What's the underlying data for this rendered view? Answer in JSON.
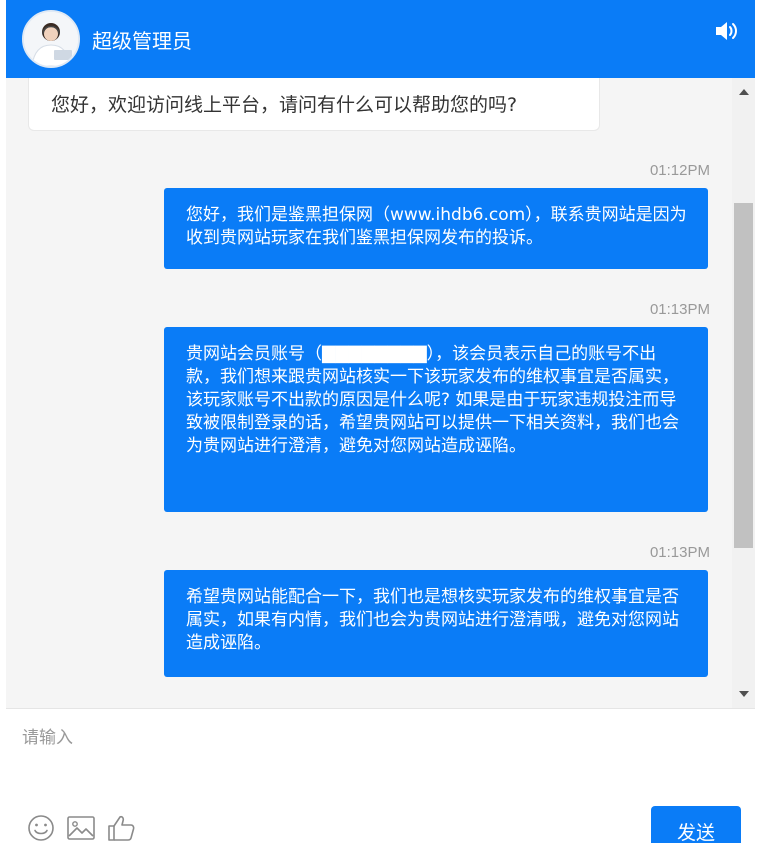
{
  "header": {
    "agent_name": "超级管理员",
    "avatar_icon": "agent-avatar",
    "speaker_icon": "speaker-icon"
  },
  "messages": [
    {
      "sender": "agent",
      "text": "您好，欢迎访问线上平台，请问有什么可以帮助您的吗?"
    },
    {
      "sender": "user",
      "time": "01:12PM",
      "text": "您好，我们是鉴黑担保网（www.ihdb6.com），联系贵网站是因为收到贵网站玩家在我们鉴黑担保网发布的投诉。"
    },
    {
      "sender": "user",
      "time": "01:13PM",
      "text": "贵网站会员账号（▇▇▇▇▇▇▇▇），该会员表示自己的账号不出款，我们想来跟贵网站核实一下该玩家发布的维权事宜是否属实，该玩家账号不出款的原因是什么呢? 如果是由于玩家违规投注而导致被限制登录的话，希望贵网站可以提供一下相关资料，我们也会为贵网站进行澄清，避免对您网站造成诬陷。"
    },
    {
      "sender": "user",
      "time": "01:13PM",
      "text": "希望贵网站能配合一下，我们也是想核实玩家发布的维权事宜是否属实，如果有内情，我们也会为贵网站进行澄清哦，避免对您网站造成诬陷。"
    }
  ],
  "input": {
    "placeholder": "请输入",
    "value": ""
  },
  "toolbar": {
    "icons": [
      "emoji-icon",
      "image-icon",
      "thumbs-up-icon"
    ],
    "send_label": "发送"
  },
  "colors": {
    "accent": "#0a7cf7",
    "chat_background": "#f5f5f5",
    "timestamp": "#999999"
  }
}
